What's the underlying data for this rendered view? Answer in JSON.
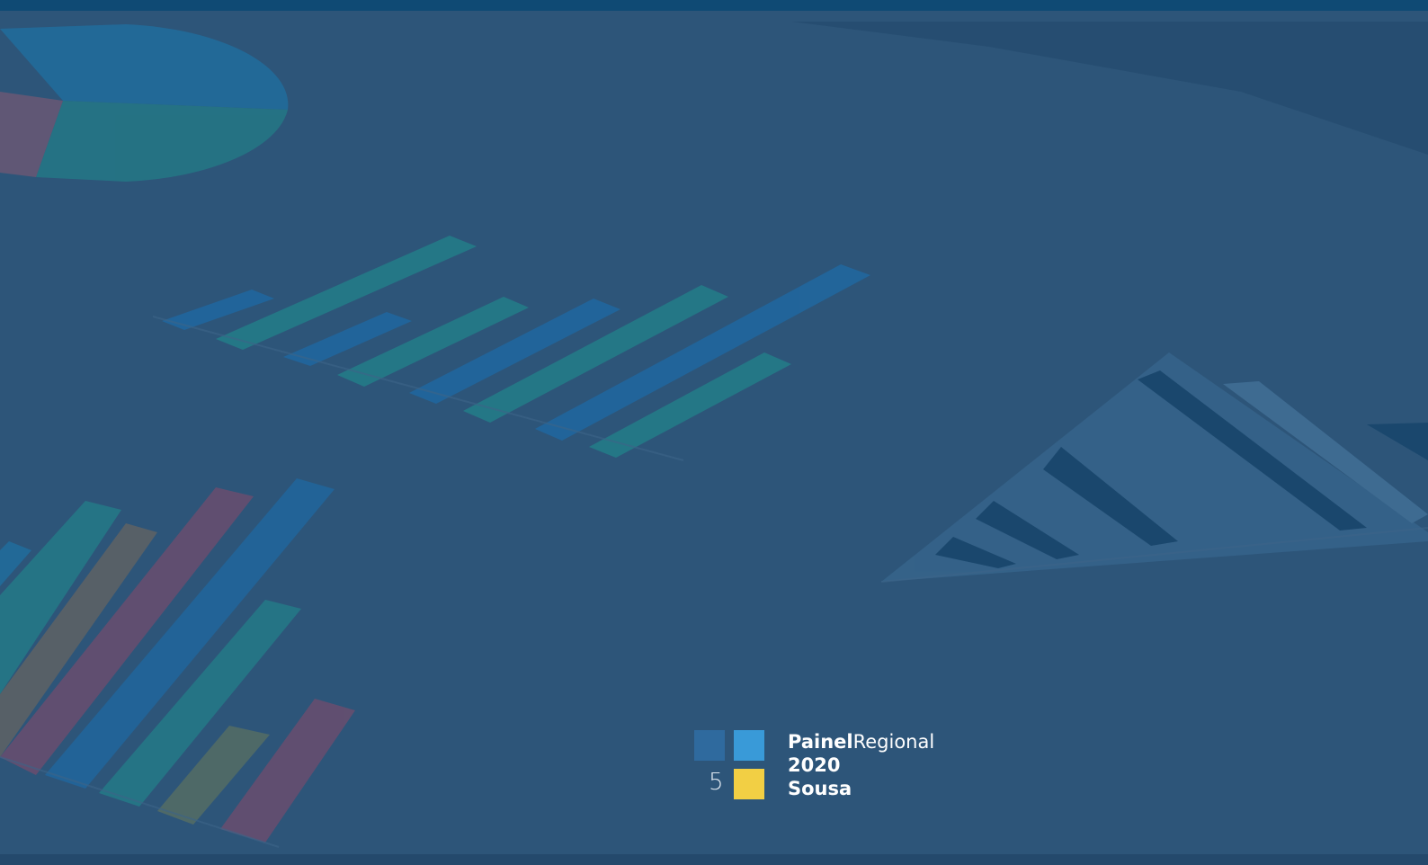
{
  "logo": {
    "number": "5",
    "brand_bold": "Painel",
    "brand_light": "Regional",
    "year": "2020",
    "region": "Sousa"
  },
  "colors": {
    "background": "#2d5579",
    "top_bar": "#0f4a74",
    "square_dark": "#2f6a9e",
    "square_light": "#399ad8",
    "square_yellow": "#f2cf44"
  }
}
